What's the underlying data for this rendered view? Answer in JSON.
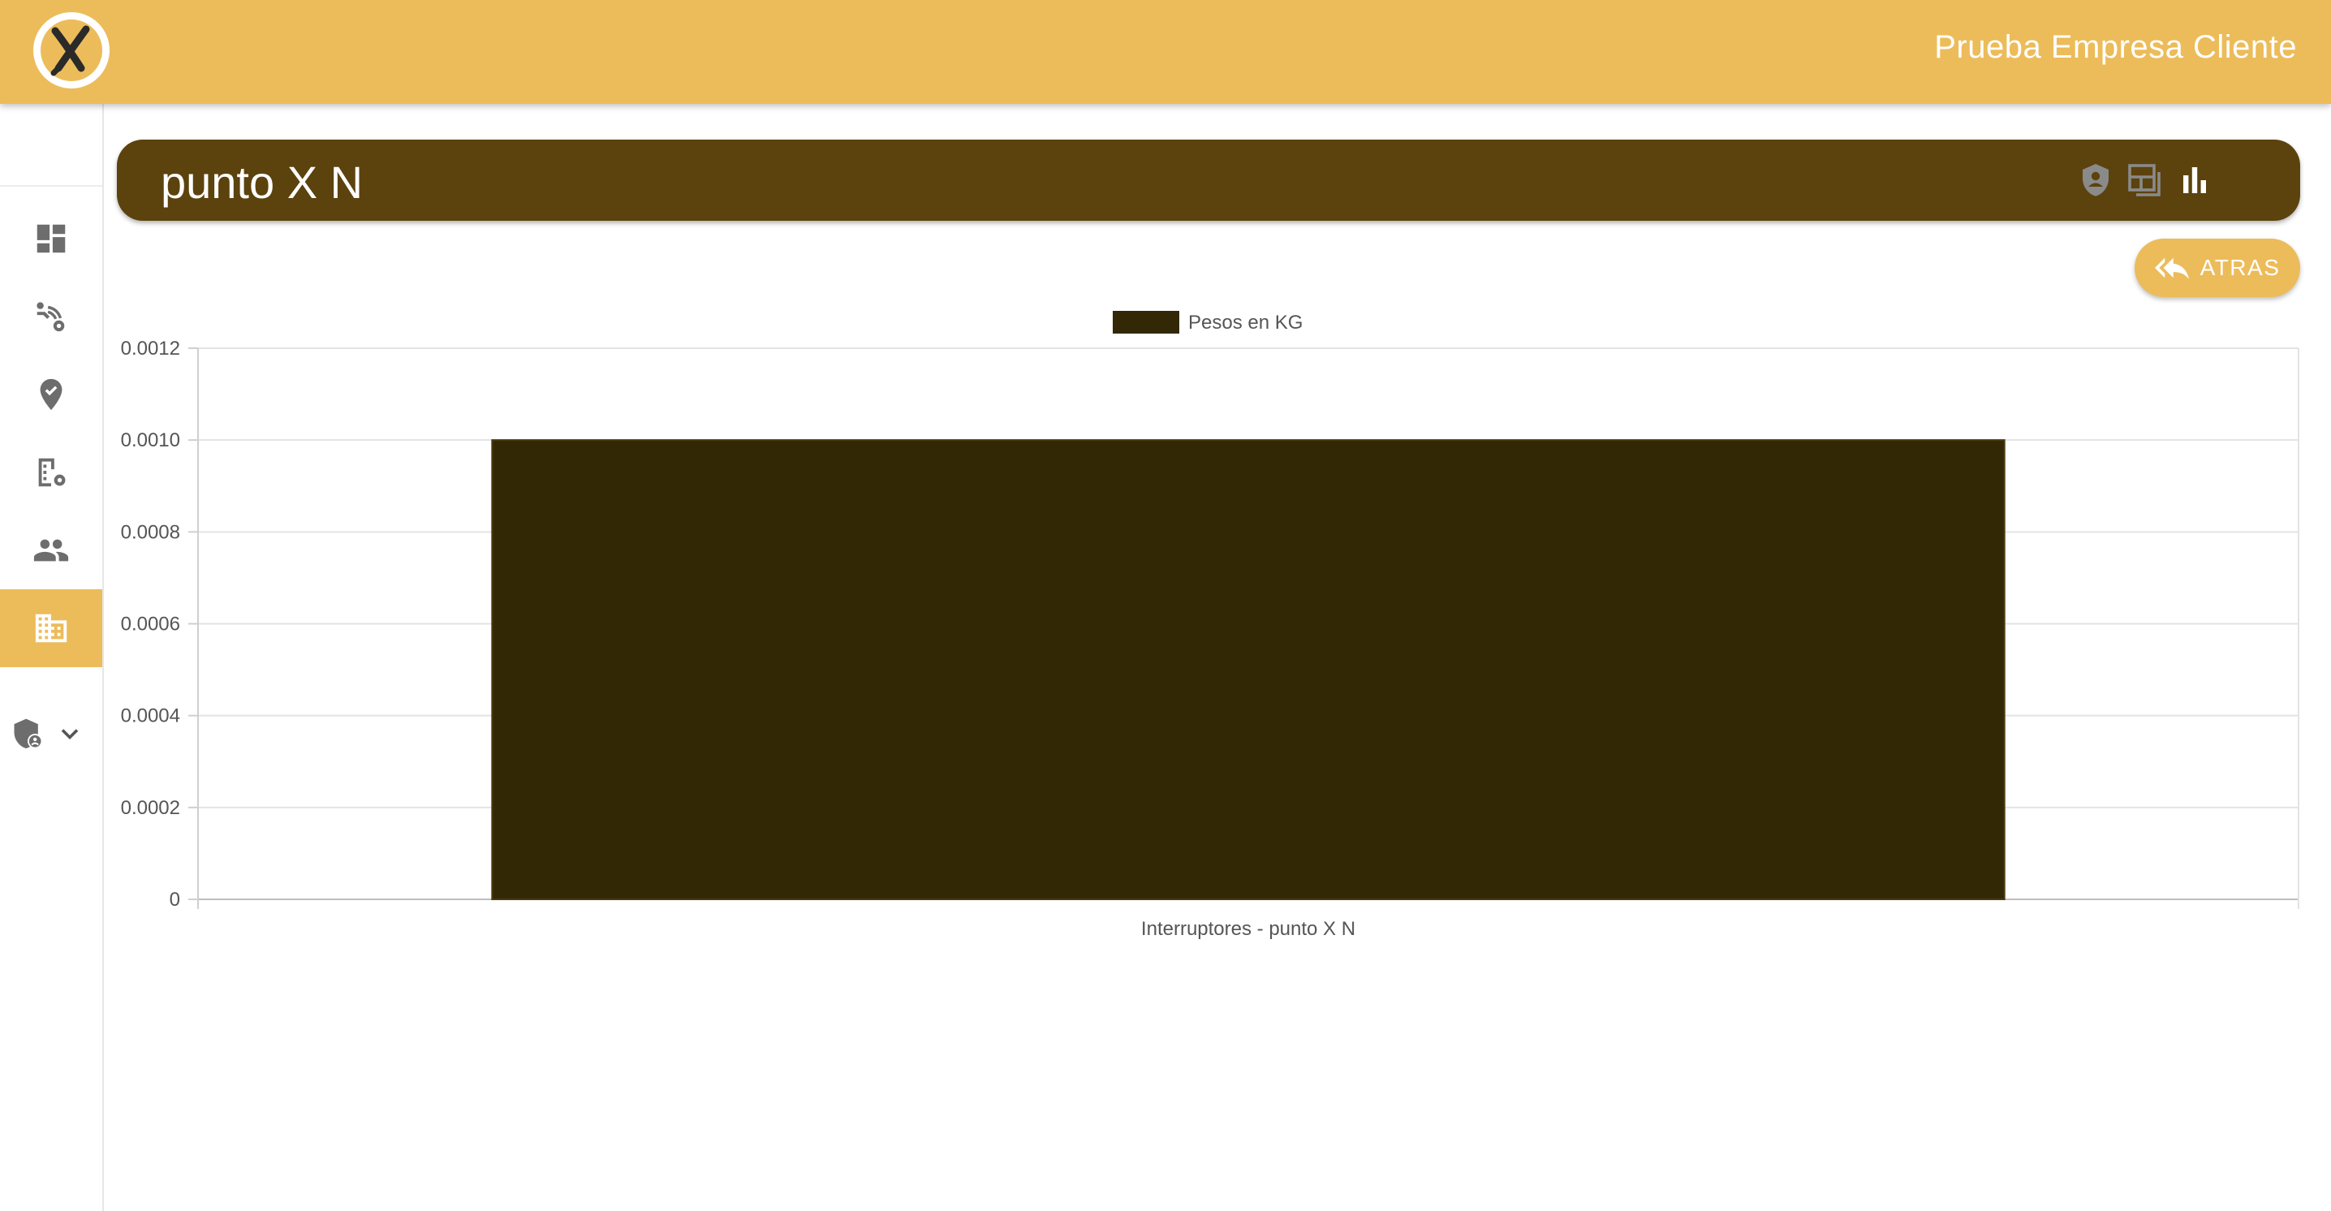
{
  "app": {
    "company_name": "Prueba Empresa Cliente",
    "brand_color": "#ecbc5a",
    "header_color": "#5c420d",
    "bar_color": "#332806",
    "logo_icon": "x-mark-logo-icon"
  },
  "sidebar": {
    "items": [
      {
        "icon": "dashboard-icon"
      },
      {
        "icon": "tracking-icon"
      },
      {
        "icon": "location-check-icon"
      },
      {
        "icon": "building-settings-icon"
      },
      {
        "icon": "people-icon"
      },
      {
        "icon": "business-icon",
        "active": true
      },
      {
        "icon": "shield-user-icon",
        "expandable": true
      }
    ]
  },
  "header": {
    "title": "punto X N",
    "icons": [
      "account-shield-icon",
      "grid-view-icon",
      "bar-chart-icon"
    ]
  },
  "actions": {
    "back_label": "ATRAS"
  },
  "chart_data": {
    "type": "bar",
    "categories": [
      "Interruptores - punto X N"
    ],
    "series": [
      {
        "name": "Pesos en KG",
        "values": [
          0.001
        ]
      }
    ],
    "ylim": [
      0,
      0.0012
    ],
    "yticks": [
      "0",
      "0.0002",
      "0.0004",
      "0.0006",
      "0.0008",
      "0.0010",
      "0.0012"
    ],
    "grid": true,
    "legend": "top"
  }
}
